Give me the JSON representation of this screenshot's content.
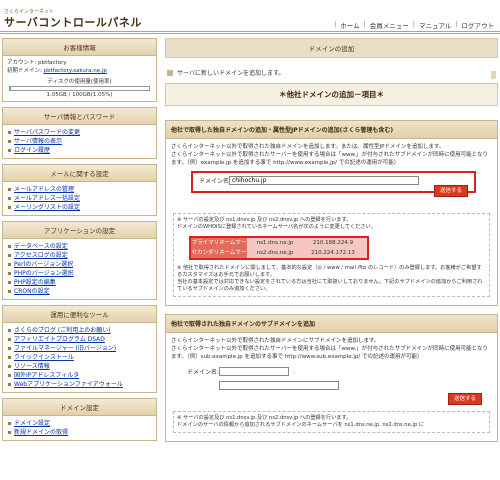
{
  "header": {
    "logo_sub": "さくらインターネット",
    "logo_main": "サーバコントロールパネル",
    "nav": [
      "ホーム",
      "会員メニュー",
      "マニュアル",
      "ログアウト"
    ]
  },
  "sidebar": {
    "customer": {
      "title": "お客様情報",
      "account_label": "アカウント:",
      "account_value": "pbtfactory",
      "domain_label": "初期ドメイン:",
      "domain_value": "pbtfactory.sakura.ne.jp",
      "disk_label": "ディスクの使用量(使用率)",
      "disk_value": "1.05GB / 100GB(1.05%)",
      "disk_percent": 1.05
    },
    "server_info": {
      "title": "サーバ情報とパスワード",
      "items": [
        "サーバパスワードの変更",
        "サーバ情報の表示",
        "ログイン履歴"
      ]
    },
    "mail": {
      "title": "メールに関する設定",
      "items": [
        "メールアドレスの管理",
        "メールアドレス一括設定",
        "メーリングリストの設定"
      ]
    },
    "app": {
      "title": "アプリケーションの設定",
      "items": [
        "データベースの設定",
        "アクセスログの設定",
        "Perlのバージョン選択",
        "PHPのバージョン選択",
        "PHP設定の編集",
        "CRONの設定"
      ]
    },
    "tools": {
      "title": "運用に便利なツール",
      "items": [
        "さくらのブログ (ご利用上のお願い)",
        "アフィリエイトプログラム DSAD",
        "ファイルマネージャー (旧バージョン)",
        "クイックインストール",
        "リソース情報",
        "国外IPアドレスフィルタ",
        "Webアプリケーションファイアウォール"
      ]
    },
    "domain": {
      "title": "ドメイン設定",
      "items": [
        "ドメイン設定",
        "新規ドメインの取得"
      ]
    }
  },
  "main": {
    "header": "ドメインの追加",
    "intro": "サーバに新しいドメインを追加します。",
    "section_title": "＊他社ドメインの追加－項目＊",
    "panel1": {
      "title": "他社で取得した独自ドメインの追加・属性型JPドメインの追加(さくら管理も含む)",
      "desc1": "さくらインターネット以外で取得された独自ドメインを追加します。または、属性型JPドメインを追加します。",
      "desc2": "さくらインターネット以外で取得されたサーバーを使用する場合は「www.」が付与されたサブドメインが同時に使用可能となります。（例）example.jp を追加する事で http://www.example.jp/ での記述の運用が可能）",
      "field_label": "ドメイン名:",
      "field_value": "chihochu.jp",
      "submit": "送信する",
      "note1": "※ サーバの設定及び ns1.dnsv.jp 及び ns2.dnsv.jp への登録を行います。",
      "note2": "ドメインのWHOISに登録されているネームサーバ名が次のように変更してください。",
      "ns": [
        {
          "key": "プライマリネームサーバ",
          "host": "ns1.dns.ne.jp",
          "ip": "210.188.224.9"
        },
        {
          "key": "セカンダリネームサーバ",
          "host": "ns2.dns.ne.jp",
          "ip": "210.224.172.13"
        }
      ],
      "note3": "※ 他社で取得されたドメインに関しまして、基本的な設定（◎ / www / mail /ftp のレコード）のみ登録します。お客様がご希望するカスタマイズはお手元でお願いします。",
      "note4": "当社の基本設定では対応できない設定をされている方は当社にて取扱いしておりません。下記のサブドメインの追加からご利用されているサブドメインのみ追加ください。"
    },
    "panel2": {
      "title": "他社で取得された独自ドメインのサブドメインを追加",
      "desc1": "さくらインターネット以外で取得された独自ドメインにサブドメインを追加します。",
      "desc2": "さくらインターネット以外で取得されたサーバーを使用する場合は「www.」が付与されたサブドメインが同時に使用可能となります。（例）sub.example.jp を追加する事で http://www.sub.example.jp/ での記述の運用が可能）",
      "field_label": "ドメイン名:",
      "dot": ".",
      "submit": "送信する",
      "note1": "※ サーバの設定及び ns1.dnsv.jp 及び ns2.dnsv.jp への登録を行います。",
      "note2": "ドメインのサーバの情報から追加されるサブドメインのネームサーバを ns1.dns.ne.jp, ns2.dns.ne.jp に"
    }
  }
}
